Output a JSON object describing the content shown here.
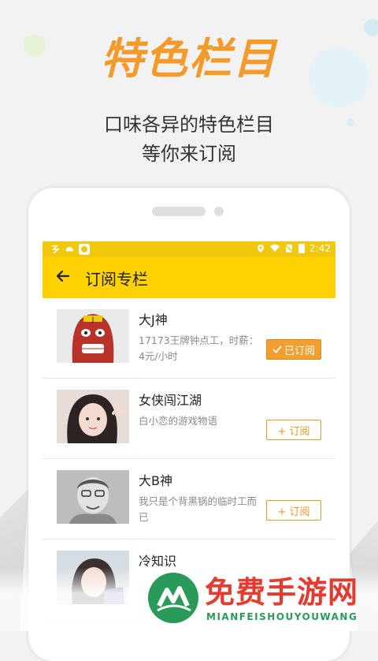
{
  "promo": {
    "headline": "特色栏目",
    "subtitle_line1": "口味各异的特色栏目",
    "subtitle_line2": "等你来订阅"
  },
  "statusbar": {
    "time": "2:42",
    "icons": [
      "app-icon",
      "cloud-icon",
      "app-badge-icon",
      "location-icon",
      "wifi-icon",
      "no-sim-icon",
      "battery-icon"
    ]
  },
  "toolbar": {
    "back_icon": "back-arrow-icon",
    "title": "订阅专栏"
  },
  "columns": [
    {
      "name": "大J神",
      "desc": "17173王牌钟点工，时薪：4元/小时",
      "button": "已订阅",
      "subscribed": true
    },
    {
      "name": "女侠闯江湖",
      "desc": "白小恋的游戏物语",
      "button": "+ 订阅",
      "subscribed": false
    },
    {
      "name": "大B神",
      "desc": "我只是个背黑锅的临时工而已",
      "button": "+ 订阅",
      "subscribed": false
    },
    {
      "name": "冷知识",
      "desc": "",
      "button": "",
      "subscribed": false
    }
  ],
  "watermark": {
    "title": "免费手游网",
    "subtitle": "MIANFEISHOUYOUWANG"
  },
  "colors": {
    "accent_orange": "#f39a2b",
    "toolbar_yellow": "#ffd200",
    "statusbar_yellow": "#f2c80f",
    "subscribed_button": "#f0a030",
    "watermark_red": "#e53b2f",
    "watermark_green": "#2a9a59"
  }
}
